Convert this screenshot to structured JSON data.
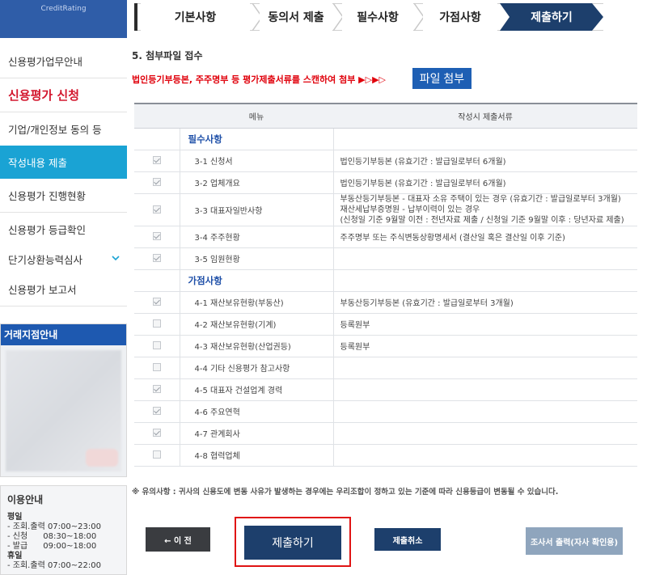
{
  "sidebar": {
    "brand": "CreditRating",
    "items": [
      {
        "label": "신용평가업무안내"
      },
      {
        "label": "신용평가 신청"
      },
      {
        "label": "기업/개인정보 동의 등"
      },
      {
        "label": "작성내용 제출"
      },
      {
        "label": "신용평가 진행현황"
      },
      {
        "label": "신용평가 등급확인"
      },
      {
        "label": "단기상환능력심사"
      },
      {
        "label": "신용평가 보고서"
      }
    ],
    "branch_title": "거래지점안내",
    "info": {
      "title": "이용안내",
      "lines": [
        "평일",
        "- 조회.출력 07:00~23:00",
        "- 신청      08:30~18:00",
        "- 발급      09:00~18:00",
        "휴일",
        "- 조회.출력 07:00~22:00"
      ]
    }
  },
  "steps": [
    "기본사항",
    "동의서 제출",
    "필수사항",
    "가점사항",
    "제출하기"
  ],
  "section_title": "5. 첨부파일 접수",
  "notice": "법인등기부등본, 주주명부 등 평가제출서류를 스캔하여 첨부 ▶▷▶▷",
  "attach_label": "파일 첨부",
  "table": {
    "headers": [
      "",
      "메뉴",
      "작성시 제출서류"
    ],
    "group1": "필수사항",
    "group2": "가점사항",
    "rows1": [
      {
        "checked": true,
        "menu": "3-1 신청서",
        "docs": "법인등기부등본 (유효기간 : 발급일로부터 6개월)"
      },
      {
        "checked": true,
        "menu": "3-2 업체개요",
        "docs": "법인등기부등본 (유효기간 : 발급일로부터 6개월)"
      },
      {
        "checked": true,
        "menu": "3-3 대표자일반사항",
        "docs": "부동산등기부등본 - 대표자 소유 주택이 있는 경우 (유효기간 : 발급일로부터 3개월)",
        "docs2": "재산세납부증명원 - 납부이력이 있는 경우",
        "docs3": "(신청일 기준 9월말 이전 : 전년자료 제출 / 신청일 기준 9월말 이후 : 당년자료 제출)"
      },
      {
        "checked": true,
        "menu": "3-4 주주현황",
        "docs": "주주명부 또는 주식변동상황명세서 (결산일 혹은 결산일 이후 기준)"
      },
      {
        "checked": true,
        "menu": "3-5 임원현황",
        "docs": ""
      }
    ],
    "rows2": [
      {
        "checked": true,
        "menu": "4-1 재산보유현황(부동산)",
        "docs": "부동산등기부등본 (유효기간 : 발급일로부터 3개월)"
      },
      {
        "checked": false,
        "menu": "4-2 재산보유현황(기계)",
        "docs": "등록원부"
      },
      {
        "checked": false,
        "menu": "4-3 재산보유현황(산업권등)",
        "docs": "등록원부"
      },
      {
        "checked": false,
        "menu": "4-4 기타 신용평가 참고사항",
        "docs": ""
      },
      {
        "checked": true,
        "menu": "4-5 대표자 건설업계 경력",
        "docs": ""
      },
      {
        "checked": true,
        "menu": "4-6 주요연혁",
        "docs": ""
      },
      {
        "checked": true,
        "menu": "4-7 관계회사",
        "docs": ""
      },
      {
        "checked": false,
        "menu": "4-8 협력업체",
        "docs": ""
      }
    ]
  },
  "caution": "※ 유의사항 : 귀사의 신용도에 변동 사유가 발생하는 경우에는 우리조합이 정하고 있는 기준에 따라 신용등급이 변동될 수 있습니다.",
  "buttons": {
    "prev": "← 이 전",
    "submit": "제출하기",
    "cancel": "제출취소",
    "print": "조사서 출력(자사 확인용)"
  },
  "colors": {
    "accent": "#1e5fb4",
    "active_nav": "#1aa3d4",
    "alert": "#e0000b",
    "step_active": "#1d3f6c"
  }
}
